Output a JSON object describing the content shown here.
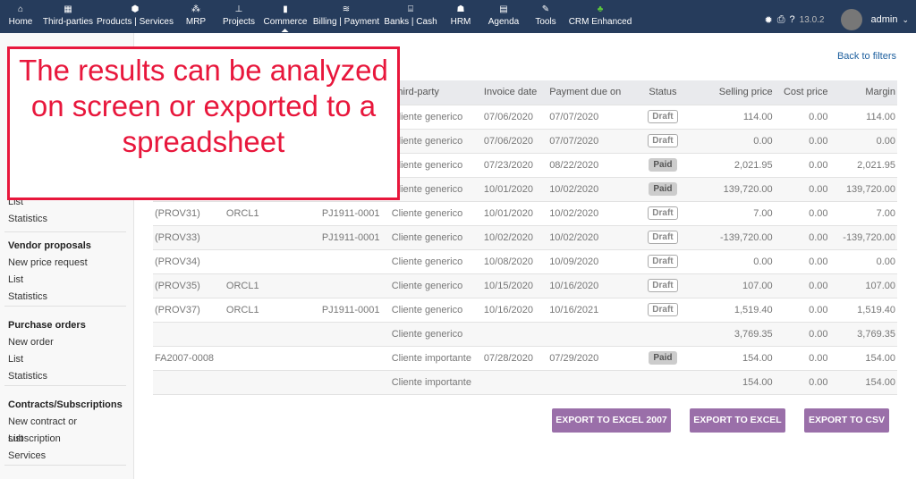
{
  "nav": {
    "items": [
      {
        "label": "Home",
        "icon": "home-icon",
        "glyph": "⌂"
      },
      {
        "label": "Third-parties",
        "icon": "building-icon",
        "glyph": "▦"
      },
      {
        "label": "Products | Services",
        "icon": "cube-icon",
        "glyph": "⬢"
      },
      {
        "label": "MRP",
        "icon": "cubes-icon",
        "glyph": "⁂"
      },
      {
        "label": "Projects",
        "icon": "sitemap-icon",
        "glyph": "⊥"
      },
      {
        "label": "Commerce",
        "icon": "briefcase-icon",
        "glyph": "▮"
      },
      {
        "label": "Billing | Payment",
        "icon": "coins-icon",
        "glyph": "≋"
      },
      {
        "label": "Banks | Cash",
        "icon": "bank-icon",
        "glyph": "⌸"
      },
      {
        "label": "HRM",
        "icon": "user-icon",
        "glyph": "☗"
      },
      {
        "label": "Agenda",
        "icon": "calendar-icon",
        "glyph": "▤"
      },
      {
        "label": "Tools",
        "icon": "wrench-icon",
        "glyph": "✎"
      },
      {
        "label": "CRM Enhanced",
        "icon": "users-icon",
        "glyph": "♣"
      }
    ],
    "version": "13.0.2",
    "user": "admin"
  },
  "sidebar": {
    "groups": [
      {
        "title": "",
        "links": [
          "List",
          "Statistics"
        ]
      },
      {
        "title": "Vendor proposals",
        "links": [
          "New price request",
          "List",
          "Statistics"
        ]
      },
      {
        "title": "Purchase orders",
        "links": [
          "New order",
          "List",
          "Statistics"
        ]
      },
      {
        "title": "Contracts/Subscriptions",
        "links": [
          "New contract or subscription",
          "List",
          "Services"
        ]
      }
    ]
  },
  "back_link": "Back to filters",
  "table": {
    "headers": [
      "",
      "",
      "",
      "Third-party",
      "Invoice date",
      "Payment due on",
      "Status",
      "Selling price",
      "Cost price",
      "Margin"
    ],
    "rows": [
      [
        "",
        "",
        "",
        "Cliente generico",
        "07/06/2020",
        "07/07/2020",
        "Draft",
        "114.00",
        "0.00",
        "114.00"
      ],
      [
        "",
        "",
        "",
        "Cliente generico",
        "07/06/2020",
        "07/07/2020",
        "Draft",
        "0.00",
        "0.00",
        "0.00"
      ],
      [
        "",
        "",
        "",
        "Cliente generico",
        "07/23/2020",
        "08/22/2020",
        "Paid",
        "2,021.95",
        "0.00",
        "2,021.95"
      ],
      [
        "",
        "",
        "",
        "Cliente generico",
        "10/01/2020",
        "10/02/2020",
        "Paid",
        "139,720.00",
        "0.00",
        "139,720.00"
      ],
      [
        "(PROV31)",
        "ORCL1",
        "PJ1911-0001",
        "Cliente generico",
        "10/01/2020",
        "10/02/2020",
        "Draft",
        "7.00",
        "0.00",
        "7.00"
      ],
      [
        "(PROV33)",
        "",
        "PJ1911-0001",
        "Cliente generico",
        "10/02/2020",
        "10/02/2020",
        "Draft",
        "-139,720.00",
        "0.00",
        "-139,720.00"
      ],
      [
        "(PROV34)",
        "",
        "",
        "Cliente generico",
        "10/08/2020",
        "10/09/2020",
        "Draft",
        "0.00",
        "0.00",
        "0.00"
      ],
      [
        "(PROV35)",
        "ORCL1",
        "",
        "Cliente generico",
        "10/15/2020",
        "10/16/2020",
        "Draft",
        "107.00",
        "0.00",
        "107.00"
      ],
      [
        "(PROV37)",
        "ORCL1",
        "PJ1911-0001",
        "Cliente generico",
        "10/16/2020",
        "10/16/2021",
        "Draft",
        "1,519.40",
        "0.00",
        "1,519.40"
      ],
      [
        "",
        "",
        "",
        "Cliente generico",
        "",
        "",
        "",
        "3,769.35",
        "0.00",
        "3,769.35"
      ],
      [
        "FA2007-0008",
        "",
        "",
        "Cliente importante",
        "07/28/2020",
        "07/29/2020",
        "Paid",
        "154.00",
        "0.00",
        "154.00"
      ],
      [
        "",
        "",
        "",
        "Cliente importante",
        "",
        "",
        "",
        "154.00",
        "0.00",
        "154.00"
      ]
    ]
  },
  "buttons": [
    "EXPORT TO EXCEL 2007",
    "EXPORT TO EXCEL",
    "EXPORT TO CSV"
  ],
  "overlay": "The results can be analyzed on screen or exported to a spreadsheet"
}
